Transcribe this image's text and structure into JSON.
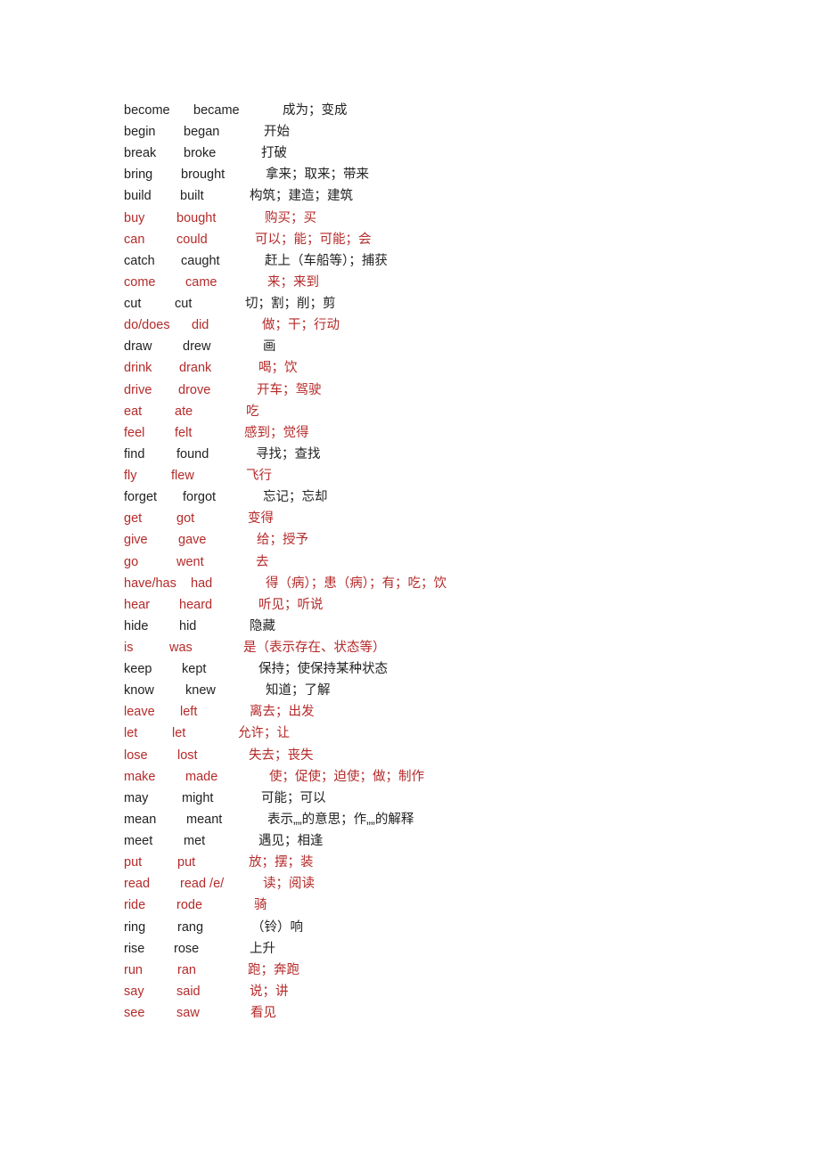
{
  "colors": {
    "default": "#222222",
    "highlight": "#b52a2a"
  },
  "verbs": [
    {
      "base": "become",
      "past": "became",
      "meaning": "成为；变成",
      "highlighted": false
    },
    {
      "base": "begin",
      "past": "began",
      "meaning": "开始",
      "highlighted": false
    },
    {
      "base": "break",
      "past": "broke",
      "meaning": "打破",
      "highlighted": false
    },
    {
      "base": "bring",
      "past": "brought",
      "meaning": "拿来；取来；带来",
      "highlighted": false
    },
    {
      "base": "build",
      "past": "built",
      "meaning": "构筑；建造；建筑",
      "highlighted": false
    },
    {
      "base": "buy",
      "past": "bought",
      "meaning": "购买；买",
      "highlighted": true
    },
    {
      "base": "can",
      "past": "could",
      "meaning": "可以；能；可能；会",
      "highlighted": true
    },
    {
      "base": "catch",
      "past": "caught",
      "meaning": "赶上（车船等）；捕获",
      "highlighted": false
    },
    {
      "base": "come",
      "past": "came",
      "meaning": "来；来到",
      "highlighted": true
    },
    {
      "base": "cut",
      "past": "cut",
      "meaning": "切；割；削；剪",
      "highlighted": false
    },
    {
      "base": "do/does",
      "past": "did",
      "meaning": "做；干；行动",
      "highlighted": true
    },
    {
      "base": "draw",
      "past": "drew",
      "meaning": "画",
      "highlighted": false
    },
    {
      "base": "drink",
      "past": "drank",
      "meaning": "喝；饮",
      "highlighted": true
    },
    {
      "base": "drive",
      "past": "drove",
      "meaning": "开车；驾驶",
      "highlighted": true
    },
    {
      "base": "eat",
      "past": "ate",
      "meaning": "吃",
      "highlighted": true
    },
    {
      "base": "feel",
      "past": "felt",
      "meaning": "感到；觉得",
      "highlighted": true
    },
    {
      "base": "find",
      "past": "found",
      "meaning": "寻找；查找",
      "highlighted": false
    },
    {
      "base": "fly",
      "past": "flew",
      "meaning": "飞行",
      "highlighted": true
    },
    {
      "base": "forget",
      "past": "forgot",
      "meaning": "忘记；忘却",
      "highlighted": false
    },
    {
      "base": "get",
      "past": "got",
      "meaning": "变得",
      "highlighted": true
    },
    {
      "base": "give",
      "past": "gave",
      "meaning": "给；授予",
      "highlighted": true
    },
    {
      "base": "go",
      "past": "went",
      "meaning": "去",
      "highlighted": true
    },
    {
      "base": "have/has",
      "past": "had",
      "meaning": "得（病）；患（病）；有；吃；饮",
      "highlighted": true
    },
    {
      "base": "hear",
      "past": "heard",
      "meaning": "听见；听说",
      "highlighted": true
    },
    {
      "base": "hide",
      "past": "hid",
      "meaning": "隐藏",
      "highlighted": false
    },
    {
      "base": "is",
      "past": "was",
      "meaning": "是（表示存在、状态等）",
      "highlighted": true
    },
    {
      "base": "keep",
      "past": "kept",
      "meaning": "保持；使保持某种状态",
      "highlighted": false
    },
    {
      "base": "know",
      "past": "knew",
      "meaning": "知道；了解",
      "highlighted": false
    },
    {
      "base": "leave",
      "past": "left",
      "meaning": "离去；出发",
      "highlighted": true
    },
    {
      "base": "let",
      "past": "let",
      "meaning": "允许；让",
      "highlighted": true
    },
    {
      "base": "lose",
      "past": "lost",
      "meaning": "失去；丧失",
      "highlighted": true
    },
    {
      "base": "make",
      "past": "made",
      "meaning": "使；促使；迫使；做；制作",
      "highlighted": true
    },
    {
      "base": "may",
      "past": "might",
      "meaning": "可能；可以",
      "highlighted": false
    },
    {
      "base": "mean",
      "past": "meant",
      "meaning": "表示„„的意思；作„„的解释",
      "highlighted": false
    },
    {
      "base": "meet",
      "past": "met",
      "meaning": "遇见；相逢",
      "highlighted": false
    },
    {
      "base": "put",
      "past": "put",
      "meaning": "放；摆；装",
      "highlighted": true
    },
    {
      "base": "read",
      "past": "read /e/",
      "meaning": "读；阅读",
      "highlighted": true
    },
    {
      "base": "ride",
      "past": "rode",
      "meaning": "骑",
      "highlighted": true
    },
    {
      "base": "ring",
      "past": "rang",
      "meaning": "（铃）响",
      "highlighted": false
    },
    {
      "base": "rise",
      "past": "rose",
      "meaning": "上升",
      "highlighted": false
    },
    {
      "base": "run",
      "past": "ran",
      "meaning": "跑；奔跑",
      "highlighted": true
    },
    {
      "base": "say",
      "past": "said",
      "meaning": "说；讲",
      "highlighted": true
    },
    {
      "base": "see",
      "past": "saw",
      "meaning": "看见",
      "highlighted": true
    }
  ]
}
